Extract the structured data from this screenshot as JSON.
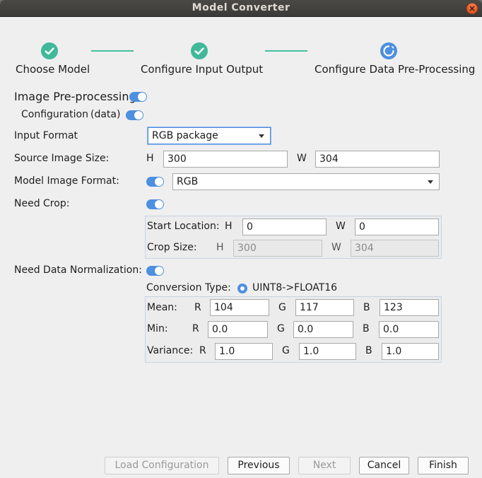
{
  "window": {
    "title": "Model Converter"
  },
  "steps": [
    {
      "label": "Choose Model",
      "state": "done",
      "icon": "check-circle-icon"
    },
    {
      "label": "Configure Input  Output",
      "state": "done",
      "icon": "check-circle-icon"
    },
    {
      "label": "Configure Data Pre-Processing",
      "state": "active",
      "icon": "progress-circle-icon"
    }
  ],
  "colors": {
    "accent": "#4d8fe0",
    "done": "#3fb99a",
    "titlebar": "#3b3a36",
    "close": "#e0541f"
  },
  "image_preprocessing": {
    "label": "Image Pre-processing",
    "enabled": true
  },
  "configuration": {
    "label": "Configuration",
    "suffix": "(data)",
    "enabled": true
  },
  "input_format": {
    "label": "Input Format",
    "value": "RGB package"
  },
  "source_size": {
    "label": "Source Image Size:",
    "h_label": "H",
    "h_value": "300",
    "w_label": "W",
    "w_value": "304"
  },
  "model_image_format": {
    "label": "Model Image Format:",
    "value": "RGB",
    "enabled": true
  },
  "need_crop": {
    "label": "Need Crop:",
    "enabled": true,
    "start_location": {
      "label": "Start Location:",
      "h_label": "H",
      "h_value": "0",
      "w_label": "W",
      "w_value": "0"
    },
    "crop_size": {
      "label": "Crop Size:",
      "h_label": "H",
      "h_value": "300",
      "w_label": "W",
      "w_value": "304"
    }
  },
  "normalization": {
    "label": "Need Data Normalization:",
    "enabled": true,
    "conversion_type": {
      "label": "Conversion Type:",
      "option": "UINT8->FLOAT16",
      "selected": true
    },
    "mean": {
      "label": "Mean:",
      "r_label": "R",
      "r": "104",
      "g_label": "G",
      "g": "117",
      "b_label": "B",
      "b": "123"
    },
    "min": {
      "label": "Min:",
      "r_label": "R",
      "r": "0.0",
      "g_label": "G",
      "g": "0.0",
      "b_label": "B",
      "b": "0.0"
    },
    "variance": {
      "label": "Variance:",
      "r_label": "R",
      "r": "1.0",
      "g_label": "G",
      "g": "1.0",
      "b_label": "B",
      "b": "1.0"
    }
  },
  "buttons": {
    "load_configuration": "Load Configuration",
    "previous": "Previous",
    "next": "Next",
    "cancel": "Cancel",
    "finish": "Finish"
  }
}
